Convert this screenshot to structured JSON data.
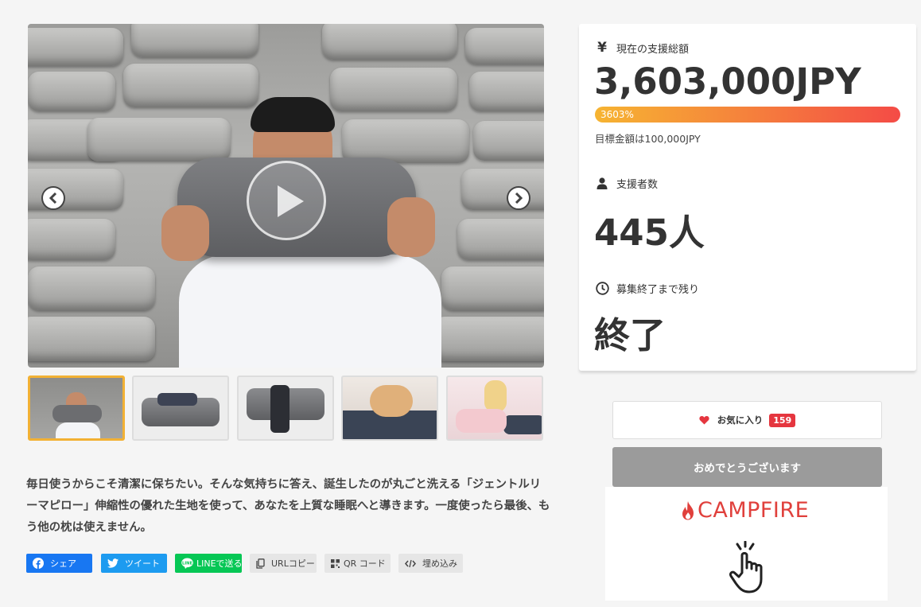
{
  "hero": {
    "play_label": "play-video",
    "prev_label": "previous",
    "next_label": "next"
  },
  "description": "毎日使うからこそ清潔に保ちたい。そんな気持ちに答え、誕生したのが丸ごと洗える「ジェントルリーマピロー」伸縮性の優れた生地を使って、あなたを上質な睡眠へと導きます。一度使ったら最後、もう他の枕は使えません。",
  "share": {
    "facebook": "シェア",
    "twitter": "ツイート",
    "line": "LINEで送る",
    "url_copy": "URLコピー",
    "qr": "QR コード",
    "embed": "埋め込み"
  },
  "stats": {
    "amount_label": "現在の支援総額",
    "amount_value": "3,603,000JPY",
    "progress_text": "3603%",
    "progress_fraction": 1.0,
    "goal_text": "目標金額は100,000JPY",
    "backers_label": "支援者数",
    "backers_value": "445人",
    "remaining_label": "募集終了まで残り",
    "remaining_value": "終了"
  },
  "actions": {
    "favorite_label": "お気に入り",
    "favorite_count": "159",
    "congrats_label": "おめでとうございます"
  },
  "brand": {
    "logo_text": "CAMPFIRE"
  },
  "colors": {
    "accent_red": "#e5363f",
    "thumb_active": "#f2b134",
    "facebook": "#1877f2",
    "twitter": "#1d9bf0",
    "line": "#06c755"
  }
}
